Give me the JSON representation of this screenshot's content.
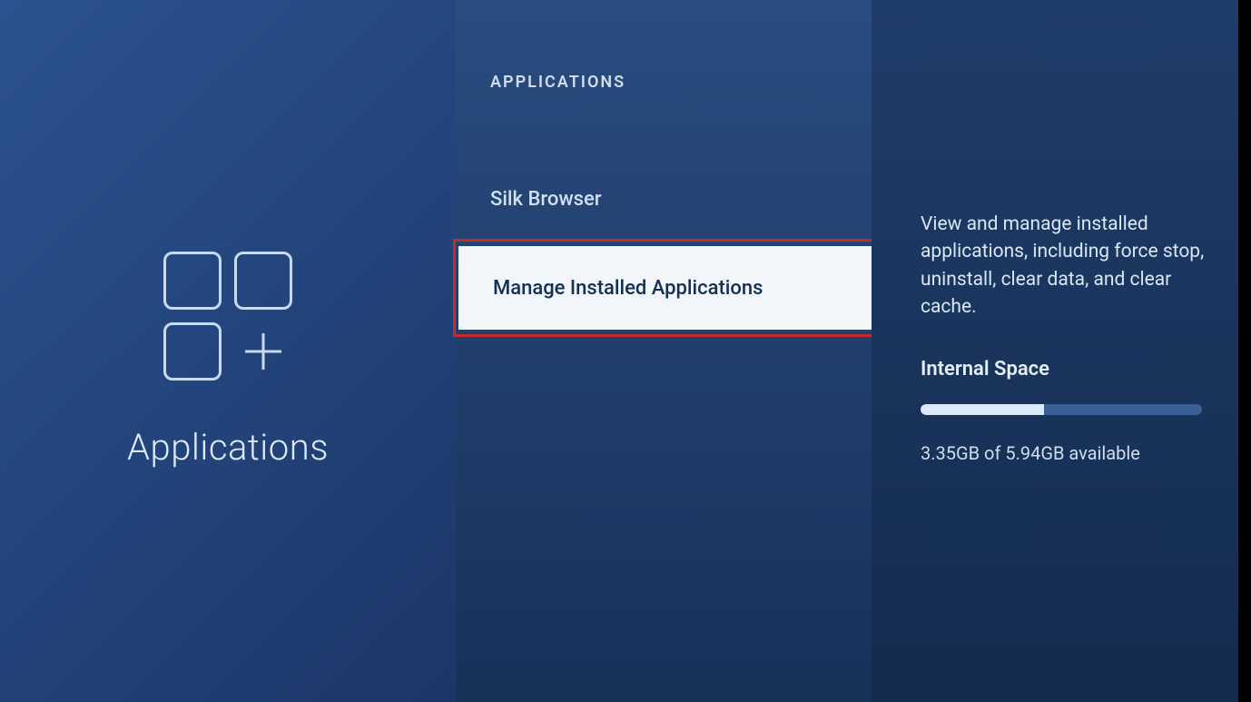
{
  "left": {
    "label": "Applications"
  },
  "middle": {
    "header": "APPLICATIONS",
    "items": [
      {
        "label": "Silk Browser",
        "selected": false
      },
      {
        "label": "Manage Installed Applications",
        "selected": true
      }
    ]
  },
  "right": {
    "description": "View and manage installed applications, including force stop, uninstall, clear data, and clear cache.",
    "storage": {
      "heading": "Internal Space",
      "used_label": "3.35GB of 5.94GB available",
      "available_gb": 3.35,
      "total_gb": 5.94,
      "fill_percent": 44
    }
  }
}
